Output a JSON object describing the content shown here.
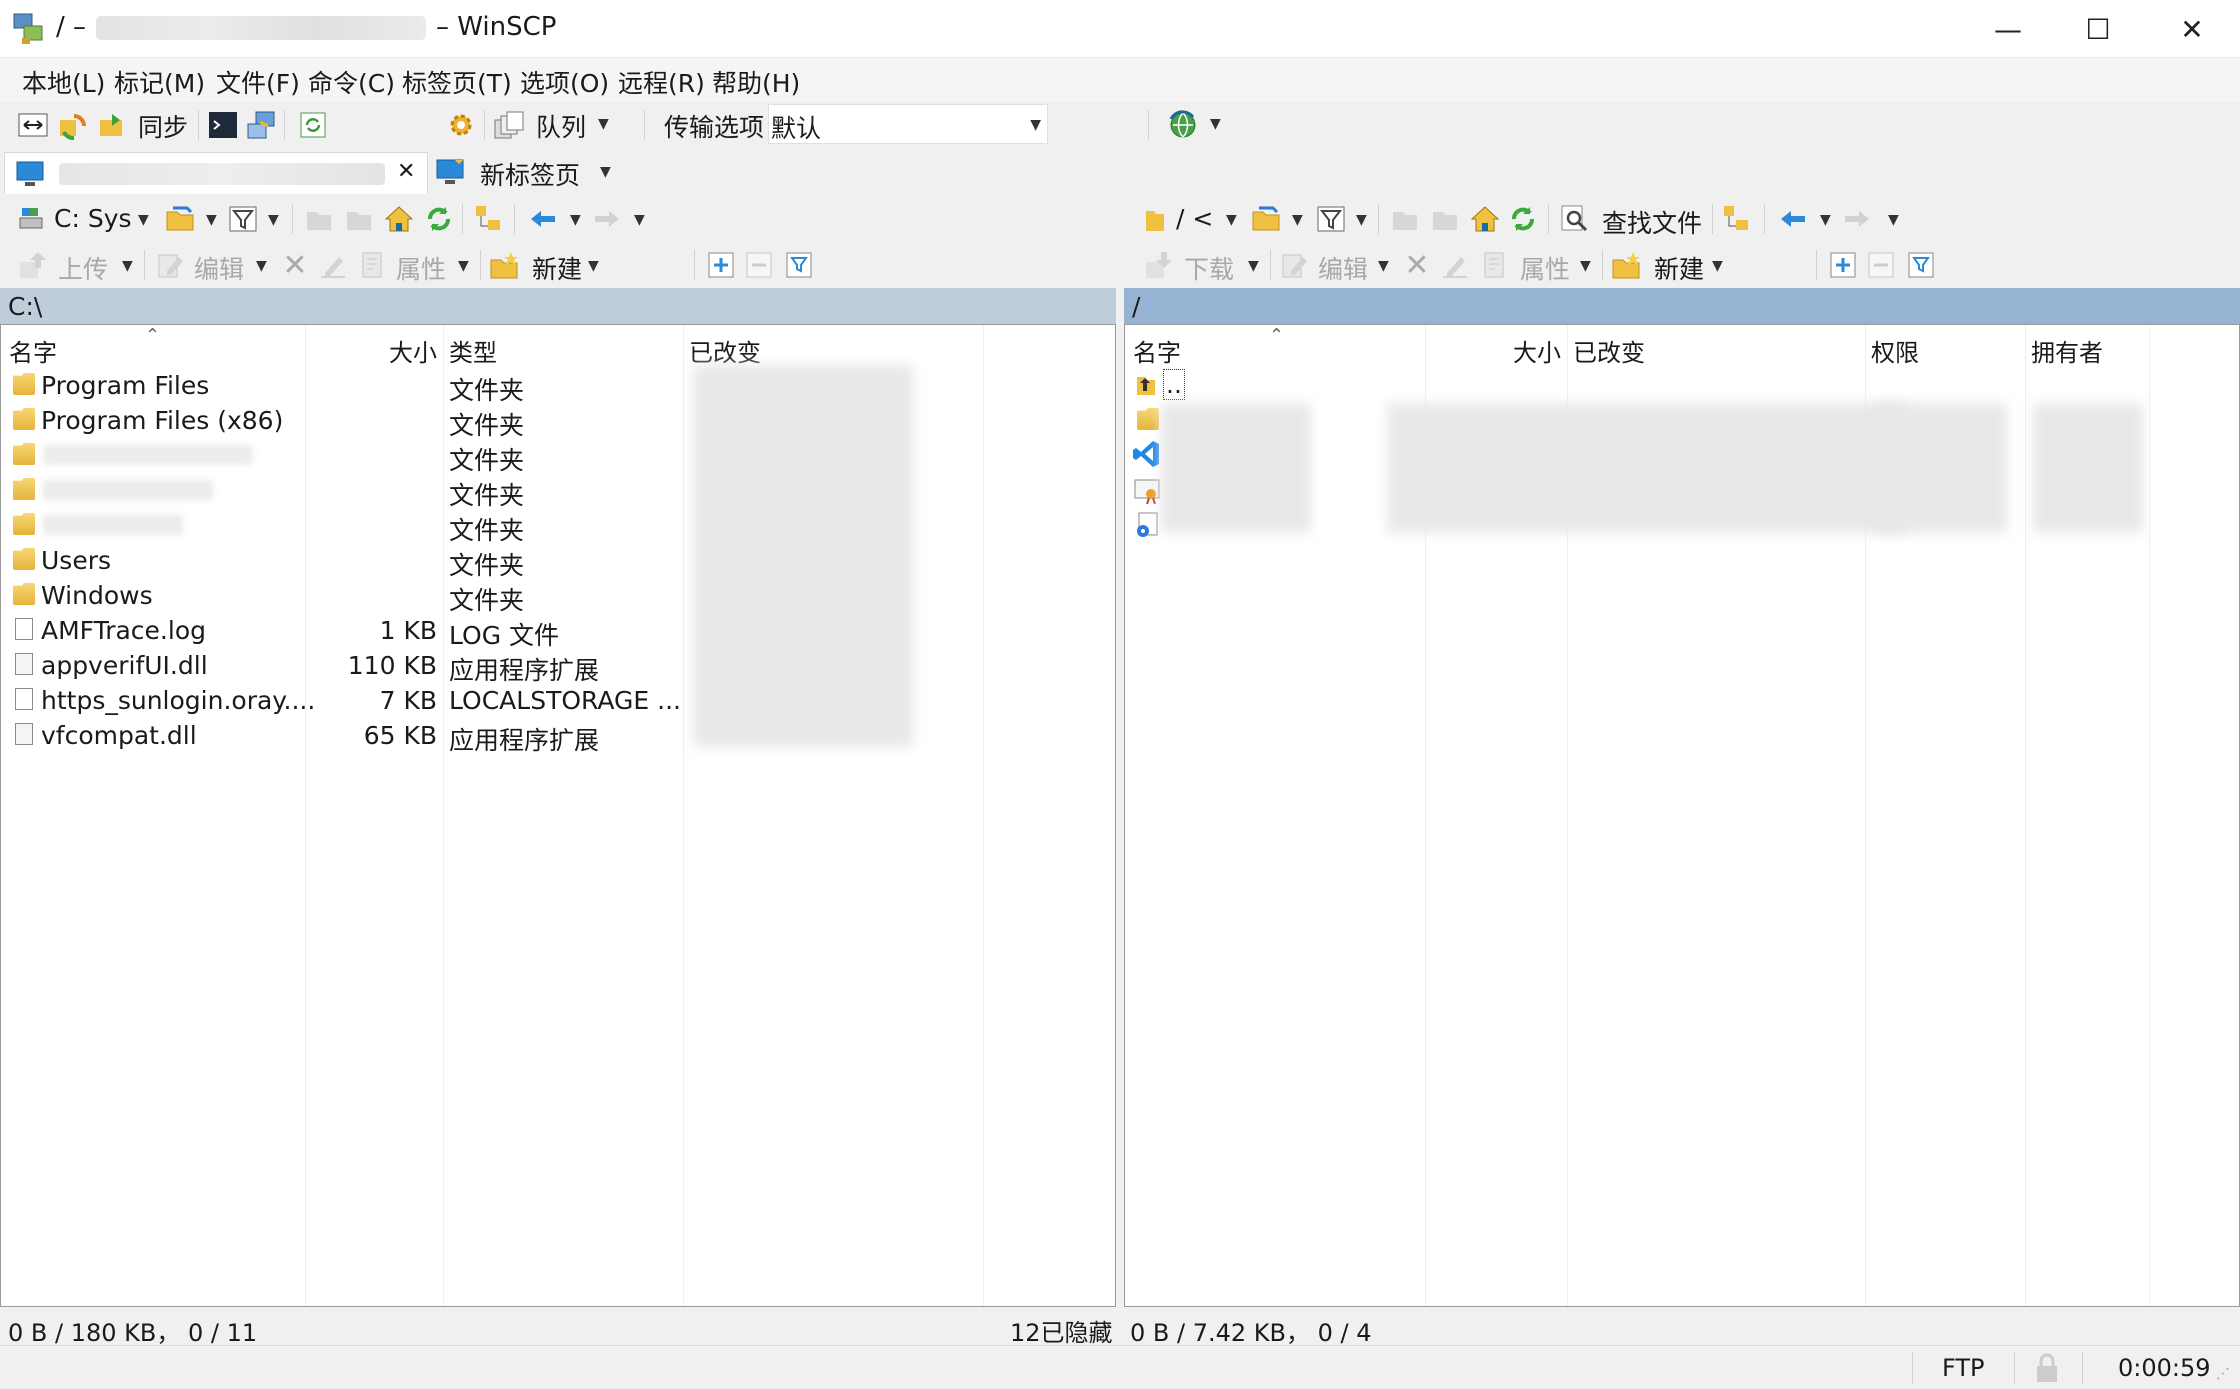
{
  "window": {
    "title_prefix": "/ –",
    "title_suffix": "– WinSCP",
    "minimize": "—",
    "maximize": "☐",
    "close": "✕"
  },
  "menu": [
    "本地(L)",
    "标记(M)",
    "文件(F)",
    "命令(C)",
    "标签页(T)",
    "选项(O)",
    "远程(R)",
    "帮助(H)"
  ],
  "toolbar": {
    "sync_label": "同步",
    "queue_label": "队列",
    "transfer_options_label": "传输选项",
    "transfer_options_value": "默认"
  },
  "tabs": {
    "new_tab_label": "新标签页",
    "close_glyph": "✕"
  },
  "left": {
    "drive_label": "C: Sys",
    "upload_label": "上传",
    "edit_label": "编辑",
    "properties_label": "属性",
    "new_label": "新建",
    "path": "C:\\",
    "columns": {
      "name": "名字",
      "size": "大小",
      "type": "类型",
      "changed": "已改变"
    },
    "files": [
      {
        "name": "Program Files",
        "size": "",
        "type": "文件夹",
        "icon": "folder-icon"
      },
      {
        "name": "Program Files (x86)",
        "size": "",
        "type": "文件夹",
        "icon": "folder-icon"
      },
      {
        "name": "",
        "size": "",
        "type": "文件夹",
        "icon": "folder-icon"
      },
      {
        "name": "",
        "size": "",
        "type": "文件夹",
        "icon": "folder-icon"
      },
      {
        "name": "",
        "size": "",
        "type": "文件夹",
        "icon": "folder-icon"
      },
      {
        "name": "Users",
        "size": "",
        "type": "文件夹",
        "icon": "folder-icon"
      },
      {
        "name": "Windows",
        "size": "",
        "type": "文件夹",
        "icon": "folder-icon"
      },
      {
        "name": "AMFTrace.log",
        "size": "1 KB",
        "type": "LOG 文件",
        "icon": "document-icon"
      },
      {
        "name": "appverifUI.dll",
        "size": "110 KB",
        "type": "应用程序扩展",
        "icon": "dll-icon"
      },
      {
        "name": "https_sunlogin.oray....",
        "size": "7 KB",
        "type": "LOCALSTORAGE ...",
        "icon": "document-icon"
      },
      {
        "name": "vfcompat.dll",
        "size": "65 KB",
        "type": "应用程序扩展",
        "icon": "dll-icon"
      }
    ],
    "status": "0 B / 180 KB， 0 / 11",
    "hidden": "12已隐藏"
  },
  "right": {
    "path_label": "/ <",
    "find_label": "查找文件",
    "download_label": "下载",
    "edit_label": "编辑",
    "properties_label": "属性",
    "new_label": "新建",
    "path": "/",
    "columns": {
      "name": "名字",
      "size": "大小",
      "changed": "已改变",
      "rights": "权限",
      "owner": "拥有者"
    },
    "parent": "..",
    "status": "0 B / 7.42 KB， 0 / 4"
  },
  "bottom": {
    "protocol": "FTP",
    "timer": "0:00:59"
  }
}
